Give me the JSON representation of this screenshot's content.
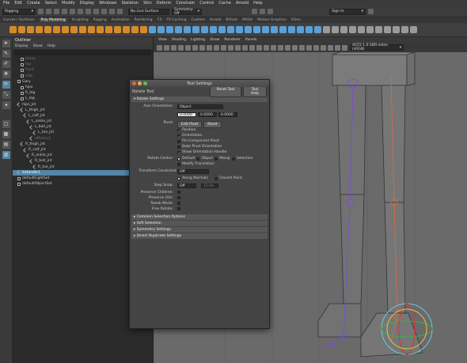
{
  "menubar": [
    "File",
    "Edit",
    "Create",
    "Select",
    "Modify",
    "Display",
    "Windows",
    "Skeleton",
    "Skin",
    "Deform",
    "Constrain",
    "Control",
    "Cache",
    "Arnold",
    "Help"
  ],
  "status": {
    "mode": "Rigging",
    "live": "No Live Surface",
    "symmetry": "Symmetry: Off",
    "signin": "Sign In"
  },
  "shelf_tabs": [
    "Curves / Surfaces",
    "Poly Modeling",
    "Sculpting",
    "Rigging",
    "Animation",
    "Rendering",
    "FX",
    "FX Caching",
    "Custom",
    "Arnold",
    "Bifrost",
    "MASH",
    "Motion Graphics",
    "XGen"
  ],
  "shelf_active": "Poly Modeling",
  "outliner": {
    "title": "Outliner",
    "menu": [
      "Display",
      "Show",
      "Help"
    ],
    "rows": [
      {
        "label": "persp",
        "indent": 2,
        "type": "cam",
        "state": "dim"
      },
      {
        "label": "top",
        "indent": 2,
        "type": "cam",
        "state": "dim"
      },
      {
        "label": "front",
        "indent": 2,
        "type": "cam",
        "state": "dim"
      },
      {
        "label": "side",
        "indent": 2,
        "type": "cam",
        "state": "dim"
      },
      {
        "label": "Gary",
        "indent": 1,
        "type": "grp",
        "state": ""
      },
      {
        "label": "hips",
        "indent": 2,
        "type": "grp",
        "state": ""
      },
      {
        "label": "R_leg",
        "indent": 2,
        "type": "grp",
        "state": ""
      },
      {
        "label": "L_leg",
        "indent": 2,
        "type": "grp",
        "state": ""
      },
      {
        "label": "hips_jnt",
        "indent": 1,
        "type": "jnt",
        "state": ""
      },
      {
        "label": "L_thigh_jnt",
        "indent": 2,
        "type": "jnt",
        "state": ""
      },
      {
        "label": "L_calf_jnt",
        "indent": 3,
        "type": "jnt",
        "state": ""
      },
      {
        "label": "L_ankle_jnt",
        "indent": 4,
        "type": "jnt",
        "state": ""
      },
      {
        "label": "L_ball_jnt",
        "indent": 5,
        "type": "jnt",
        "state": ""
      },
      {
        "label": "L_toe_jnt",
        "indent": 6,
        "type": "jnt",
        "state": ""
      },
      {
        "label": "effector1",
        "indent": 5,
        "type": "jnt",
        "state": "dim"
      },
      {
        "label": "R_thigh_jnt",
        "indent": 2,
        "type": "jnt",
        "state": ""
      },
      {
        "label": "R_calf_jnt",
        "indent": 3,
        "type": "jnt",
        "state": ""
      },
      {
        "label": "R_ankle_jnt",
        "indent": 4,
        "type": "jnt",
        "state": ""
      },
      {
        "label": "R_ball_jnt",
        "indent": 5,
        "type": "jnt",
        "state": ""
      },
      {
        "label": "R_toe_jnt",
        "indent": 6,
        "type": "jnt",
        "state": ""
      },
      {
        "label": "ikHandle1",
        "indent": 1,
        "type": "jnt",
        "state": "sel"
      },
      {
        "label": "defaultLightSet",
        "indent": 1,
        "type": "grp",
        "state": ""
      },
      {
        "label": "defaultObjectSet",
        "indent": 1,
        "type": "grp",
        "state": ""
      }
    ]
  },
  "viewport_menu": [
    "View",
    "Shading",
    "Lighting",
    "Show",
    "Renderer",
    "Panels"
  ],
  "viewport_colorspace": "ACES 1.0 SDR-video (sRGB)",
  "tool_settings": {
    "title": "Tool Settings",
    "tool_name": "Rotate Tool",
    "reset_label": "Reset Tool",
    "help_label": "Tool Help",
    "rotate_section": "Rotate Settings",
    "axis_orientation_label": "Axis Orientation:",
    "axis_orientation_value": "Object",
    "values": [
      "0.0000",
      "0.0000",
      "0.0000"
    ],
    "pivot_label": "Pivot:",
    "edit_pivot": "Edit Pivot",
    "reset": "Reset",
    "pivot_options": [
      {
        "label": "Position",
        "checked": true
      },
      {
        "label": "Orientation",
        "checked": true
      },
      {
        "label": "Pin Component Pivot",
        "checked": false
      },
      {
        "label": "Bake Pivot Orientation",
        "checked": false
      },
      {
        "label": "Show Orientation Handle",
        "checked": true
      }
    ],
    "rotate_center_label": "Rotate Center:",
    "rotate_center_options": [
      "Default",
      "Object",
      "Manip",
      "Selection"
    ],
    "modify_translation": "Modify Translation",
    "transform_constraint_label": "Transform Constraint:",
    "transform_constraint_value": "Off",
    "along_normals": "Along Normals",
    "closest_point": "Closest Point",
    "step_snap_label": "Step Snap:",
    "step_snap_value": "Off",
    "step_snap_amount": "15.00",
    "preserve_children": "Preserve Children:",
    "preserve_uvs": "Preserve UVs:",
    "tweak_mode": "Tweak Mode:",
    "free_rotate": "Free Rotate:",
    "collapsed_sections": [
      "Common Selection Options",
      "Soft Selection",
      "Symmetry Settings",
      "Smart Duplicate Settings"
    ]
  },
  "colors": {
    "accent": "#5285a6",
    "rig_purple": "#7a4fd1",
    "rig_orange": "#e06a3a"
  }
}
